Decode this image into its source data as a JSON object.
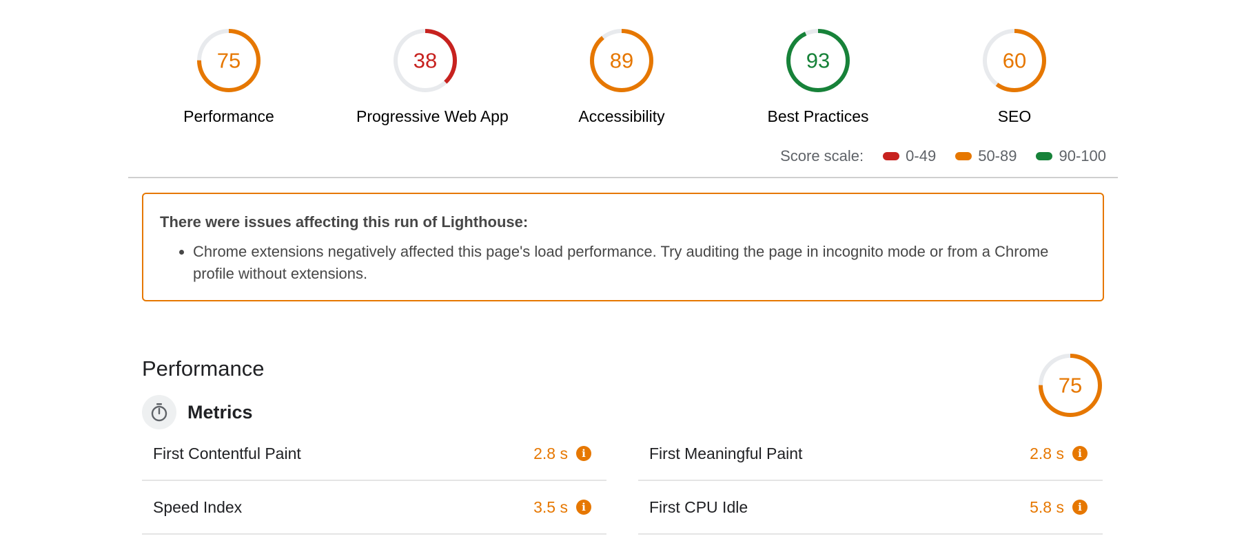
{
  "gauges": [
    {
      "score": 75,
      "label": "Performance",
      "color": "#e67700"
    },
    {
      "score": 38,
      "label": "Progressive Web App",
      "color": "#c7221f"
    },
    {
      "score": 89,
      "label": "Accessibility",
      "color": "#e67700"
    },
    {
      "score": 93,
      "label": "Best Practices",
      "color": "#178239"
    },
    {
      "score": 60,
      "label": "SEO",
      "color": "#e67700"
    }
  ],
  "score_scale": {
    "label": "Score scale:",
    "ranges": [
      {
        "label": "0-49",
        "color": "#c7221f"
      },
      {
        "label": "50-89",
        "color": "#e67700"
      },
      {
        "label": "90-100",
        "color": "#178239"
      }
    ]
  },
  "warning": {
    "title": "There were issues affecting this run of Lighthouse:",
    "items": [
      "Chrome extensions negatively affected this page's load performance. Try auditing the page in incognito mode or from a Chrome profile without extensions."
    ]
  },
  "performance": {
    "title": "Performance",
    "score": 75,
    "score_color": "#e67700",
    "metrics_title": "Metrics",
    "metrics": [
      {
        "name": "First Contentful Paint",
        "value": "2.8 s"
      },
      {
        "name": "First Meaningful Paint",
        "value": "2.8 s"
      },
      {
        "name": "Speed Index",
        "value": "3.5 s"
      },
      {
        "name": "First CPU Idle",
        "value": "5.8 s"
      }
    ]
  },
  "icons": {
    "info": "info-icon",
    "metrics": "stopwatch-icon"
  }
}
